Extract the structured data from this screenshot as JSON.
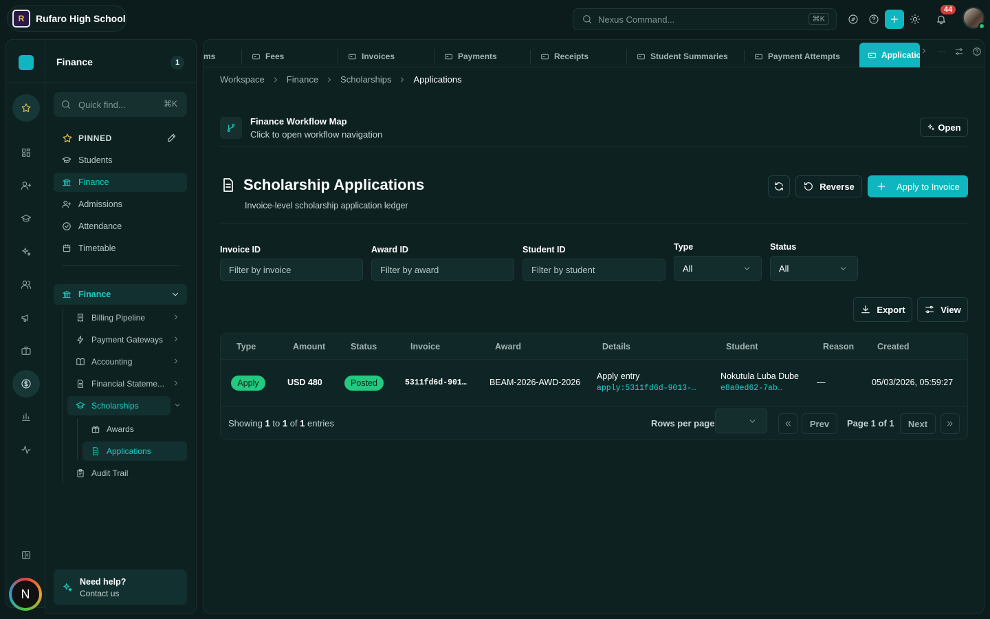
{
  "app": {
    "school": "Rufaro High School",
    "school_initial": "R"
  },
  "search": {
    "placeholder": "Nexus Command...",
    "shortcut": "⌘K"
  },
  "notifications": {
    "count": "44"
  },
  "rail": {
    "user_initial": "N"
  },
  "sidebar": {
    "title": "Finance",
    "count": "1",
    "quick_find": {
      "placeholder": "Quick find...",
      "shortcut": "⌘K"
    },
    "pinned_label": "PINNED",
    "pinned": [
      {
        "label": "Students",
        "icon": "graduation-cap-icon"
      },
      {
        "label": "Finance",
        "icon": "bank-icon"
      },
      {
        "label": "Admissions",
        "icon": "user-plus-icon"
      },
      {
        "label": "Attendance",
        "icon": "check-circle-icon"
      },
      {
        "label": "Timetable",
        "icon": "calendar-icon"
      }
    ],
    "section": "Finance",
    "items": [
      {
        "label": "Billing Pipeline",
        "icon": "receipt-icon"
      },
      {
        "label": "Payment Gateways",
        "icon": "bolt-icon"
      },
      {
        "label": "Accounting",
        "icon": "book-icon"
      },
      {
        "label": "Financial Stateme...",
        "icon": "document-icon"
      },
      {
        "label": "Scholarships",
        "icon": "graduation-cap-icon"
      },
      {
        "label": "Awards",
        "icon": "gift-icon"
      },
      {
        "label": "Applications",
        "icon": "document-icon"
      },
      {
        "label": "Audit Trail",
        "icon": "clipboard-icon"
      }
    ],
    "help": {
      "title": "Need help?",
      "subtitle": "Contact us"
    }
  },
  "tabs": [
    {
      "label": "ms"
    },
    {
      "label": "Fees"
    },
    {
      "label": "Invoices"
    },
    {
      "label": "Payments"
    },
    {
      "label": "Receipts"
    },
    {
      "label": "Student Summaries"
    },
    {
      "label": "Payment Attempts"
    },
    {
      "label": "Application"
    }
  ],
  "breadcrumb": [
    "Workspace",
    "Finance",
    "Scholarships",
    "Applications"
  ],
  "workflow": {
    "title": "Finance Workflow Map",
    "subtitle": "Click to open workflow navigation",
    "open": "Open"
  },
  "page": {
    "title": "Scholarship Applications",
    "subtitle": "Invoice-level scholarship application ledger"
  },
  "actions": {
    "reverse": "Reverse",
    "apply": "Apply to Invoice",
    "export": "Export",
    "view": "View"
  },
  "filters": {
    "invoice": {
      "label": "Invoice ID",
      "placeholder": "Filter by invoice"
    },
    "award": {
      "label": "Award ID",
      "placeholder": "Filter by award"
    },
    "student": {
      "label": "Student ID",
      "placeholder": "Filter by student"
    },
    "type": {
      "label": "Type",
      "value": "All"
    },
    "status": {
      "label": "Status",
      "value": "All"
    }
  },
  "table": {
    "columns": [
      "Type",
      "Amount",
      "Status",
      "Invoice",
      "Award",
      "Details",
      "Student",
      "Reason",
      "Created"
    ],
    "rows": [
      {
        "type": "Apply",
        "amount": "USD 480",
        "status": "Posted",
        "invoice": "5311fd6d-901…",
        "award": "BEAM-2026-AWD-2026",
        "details_title": "Apply entry",
        "details_code": "apply:5311fd6d-9013-…",
        "student_name": "Nokutula Luba Dube",
        "student_id": "e8a0ed62-7ab…",
        "reason": "—",
        "created": "05/03/2026, 05:59:27"
      }
    ]
  },
  "pagination": {
    "showing_prefix": "Showing",
    "from": "1",
    "to_word": "to",
    "to": "1",
    "of_word": "of",
    "total": "1",
    "entries": "entries",
    "rows_per_page": "Rows per page",
    "prev": "Prev",
    "page_info": "Page 1 of 1",
    "next": "Next"
  },
  "colors": {
    "accent": "#0fb6bf",
    "teal_text": "#19d2c8",
    "posted": "#22c97e",
    "apply": "#22c97e",
    "danger": "#d63a3a"
  }
}
